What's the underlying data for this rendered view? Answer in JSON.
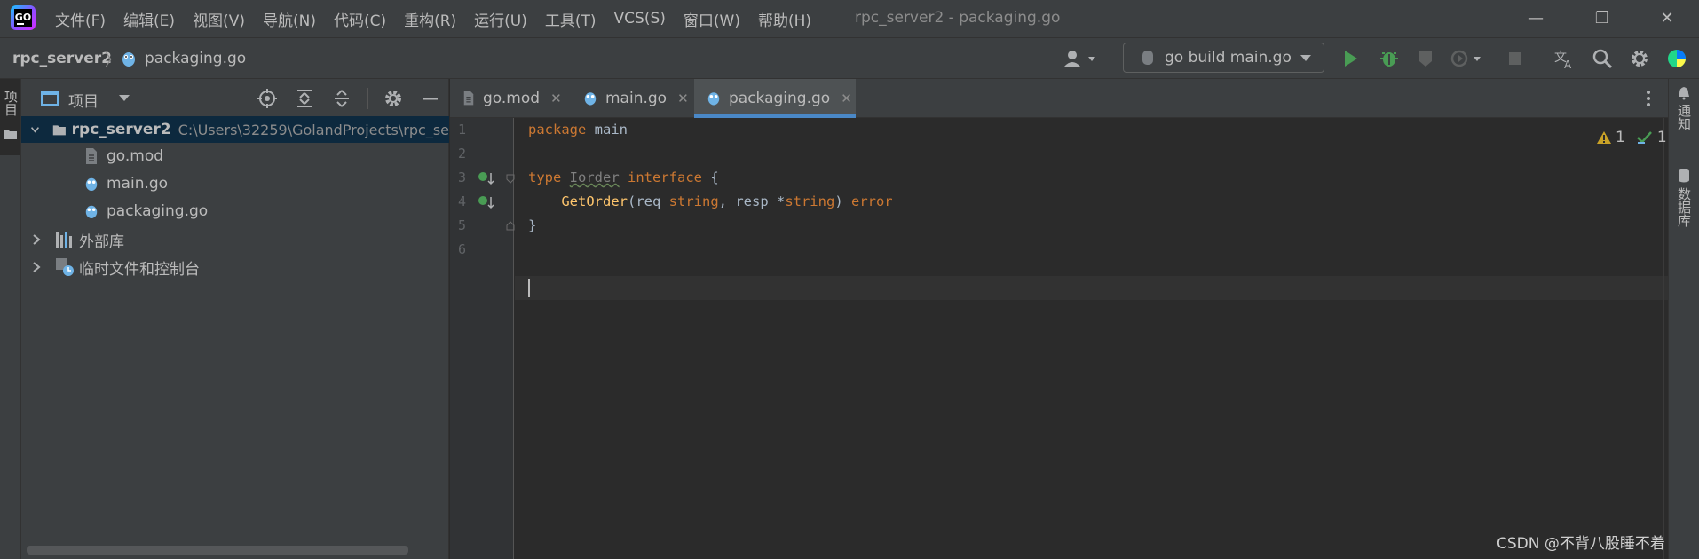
{
  "app": {
    "window_title": "rpc_server2 - packaging.go"
  },
  "menu": {
    "items": [
      "文件(F)",
      "编辑(E)",
      "视图(V)",
      "导航(N)",
      "代码(C)",
      "重构(R)",
      "运行(U)",
      "工具(T)",
      "VCS(S)",
      "窗口(W)",
      "帮助(H)"
    ]
  },
  "window_controls": {
    "minimize": "—",
    "restore": "❐",
    "close": "✕"
  },
  "breadcrumb": {
    "project": "rpc_server2",
    "separator": "〉",
    "file": "packaging.go"
  },
  "toolbar": {
    "run_config": "go build main.go"
  },
  "left_strip": {
    "label": "项目"
  },
  "project_panel": {
    "title": "项目",
    "root": {
      "name": "rpc_server2",
      "path": "C:\\Users\\32259\\GolandProjects\\rpc_se"
    },
    "files": [
      "go.mod",
      "main.go",
      "packaging.go"
    ],
    "groups": [
      "外部库",
      "临时文件和控制台"
    ]
  },
  "editor": {
    "tabs": [
      {
        "label": "go.mod",
        "close": "✕",
        "active": false
      },
      {
        "label": "main.go",
        "close": "✕",
        "active": false
      },
      {
        "label": "packaging.go",
        "close": "✕",
        "active": true
      }
    ],
    "line_numbers": [
      "1",
      "2",
      "3",
      "4",
      "5",
      "6"
    ],
    "code": {
      "l1_kw": "package",
      "l1_name": " main",
      "l3_kw": "type",
      "l3_name": "Iorder",
      "l3_kw2": "interface",
      "l3_brace": " {",
      "l4_indent": "    ",
      "l4_fn": "GetOrder",
      "l4_p1": "(req ",
      "l4_t1": "string",
      "l4_p2": ", resp *",
      "l4_t2": "string",
      "l4_p3": ") ",
      "l4_ret": "error",
      "l5": "}"
    },
    "inspections": {
      "warnings": "1",
      "ok": "1"
    }
  },
  "right_strip": {
    "notifications": "通知",
    "database": "数据库"
  },
  "watermark": "CSDN @不背八股睡不着",
  "colors": {
    "accent_tab": "#4a88c7",
    "run_green": "#499c54",
    "keyword": "#cc7832",
    "function": "#ffc66d",
    "warning": "#c9a227"
  }
}
